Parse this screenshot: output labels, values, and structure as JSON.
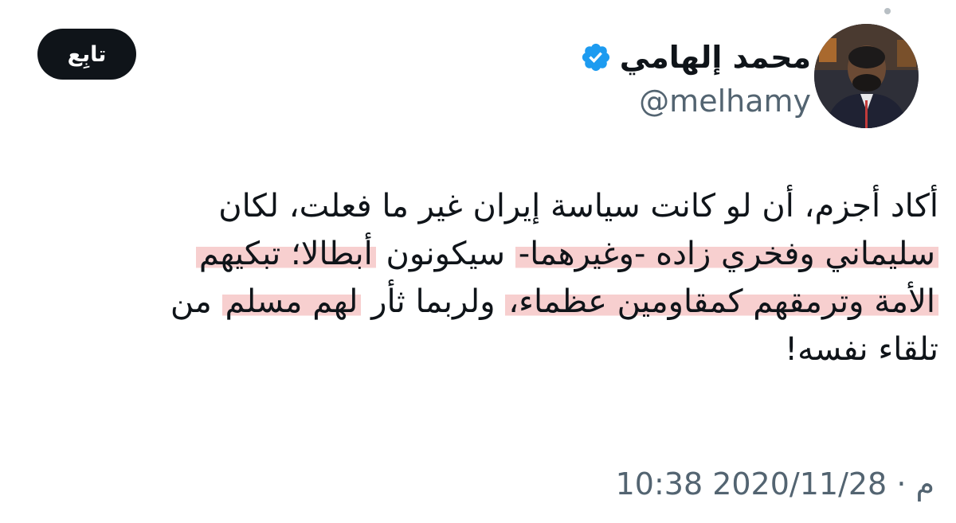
{
  "author": {
    "display_name": "محمد إلهامي",
    "handle": "@melhamy",
    "verified": true,
    "verified_icon": "verified-badge-icon",
    "avatar": "avatar-photo"
  },
  "actions": {
    "follow_label": "تابِع"
  },
  "tweet": {
    "line1": "أكاد أجزم، أن لو كانت سياسة إيران غير ما فعلت، لكان",
    "line2": {
      "hl_a": "سليماني وفخري زاده -وغيرهما-",
      "plain": " سيكونون ",
      "hl_b": "أبطالا؛ تبكيهم"
    },
    "line3": {
      "hl_a": "الأمة وترمقهم كمقاومين عظماء،",
      "plain": " ولربما ثأر ",
      "hl_b": "لهم مسلم",
      "tail": " من"
    },
    "line4": "تلقاء نفسه!"
  },
  "meta": {
    "timestamp": "10:38 م · 2020/11/28"
  },
  "colors": {
    "text": "#0f1419",
    "secondary_text": "#536471",
    "verified_blue": "#1d9bf0",
    "button_bg": "#0f1419",
    "highlight": "#ec8c8c"
  }
}
